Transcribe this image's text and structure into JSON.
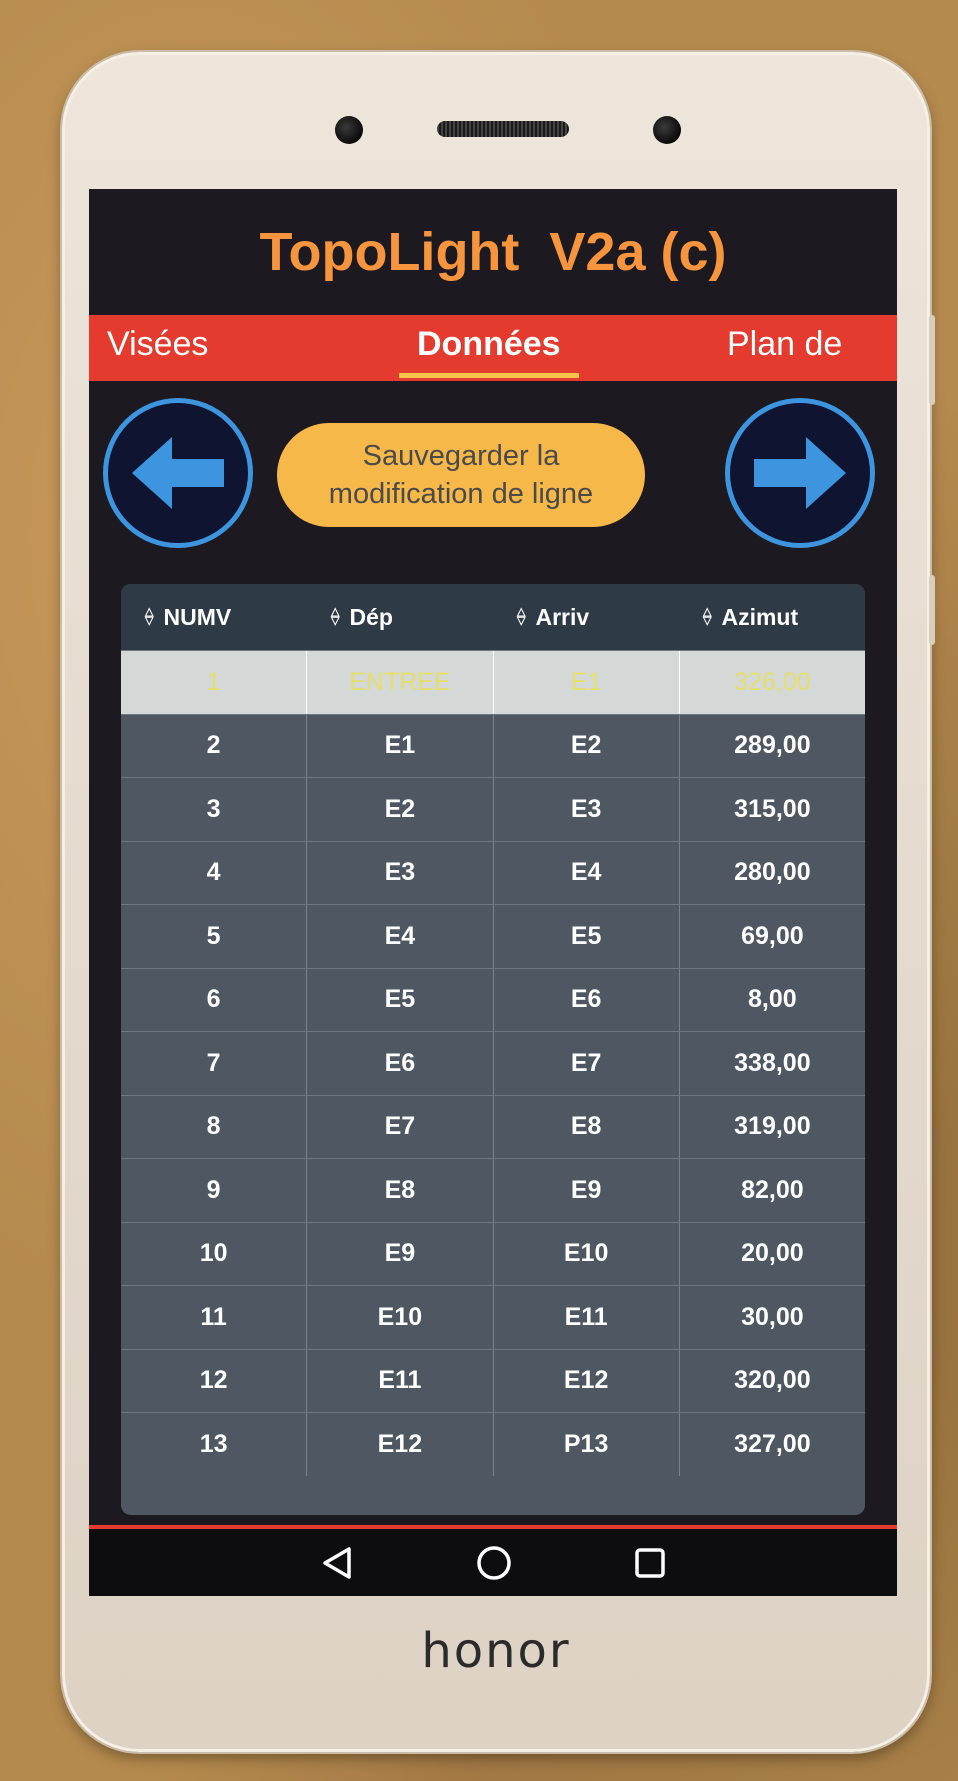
{
  "app": {
    "title": "TopoLight  V2a (c)"
  },
  "tabs": [
    {
      "label": "Visées",
      "active": false
    },
    {
      "label": "Données",
      "active": true
    },
    {
      "label": "Plan de",
      "active": false
    }
  ],
  "actions": {
    "save_line1": "Sauvegarder la",
    "save_line2": "modification de ligne",
    "prev_icon": "arrow-left-icon",
    "next_icon": "arrow-right-icon"
  },
  "table": {
    "columns": [
      "NUMV",
      "Dép",
      "Arriv",
      "Azimut"
    ],
    "selected_row": 0,
    "rows": [
      [
        "1",
        "ENTREE",
        "E1",
        "326,00"
      ],
      [
        "2",
        "E1",
        "E2",
        "289,00"
      ],
      [
        "3",
        "E2",
        "E3",
        "315,00"
      ],
      [
        "4",
        "E3",
        "E4",
        "280,00"
      ],
      [
        "5",
        "E4",
        "E5",
        "69,00"
      ],
      [
        "6",
        "E5",
        "E6",
        "8,00"
      ],
      [
        "7",
        "E6",
        "E7",
        "338,00"
      ],
      [
        "8",
        "E7",
        "E8",
        "319,00"
      ],
      [
        "9",
        "E8",
        "E9",
        "82,00"
      ],
      [
        "10",
        "E9",
        "E10",
        "20,00"
      ],
      [
        "11",
        "E10",
        "E11",
        "30,00"
      ],
      [
        "12",
        "E11",
        "E12",
        "320,00"
      ],
      [
        "13",
        "E12",
        "P13",
        "327,00"
      ]
    ]
  },
  "system_nav": {
    "back_icon": "triangle-back-icon",
    "home_icon": "circle-home-icon",
    "recents_icon": "square-recents-icon"
  },
  "device": {
    "brand": "honor"
  },
  "colors": {
    "title": "#f6953e",
    "tab_bar": "#e53a2e",
    "save_button": "#f7b84a",
    "nav_ring": "#3d95e0",
    "selected_text": "#e6df6c"
  }
}
